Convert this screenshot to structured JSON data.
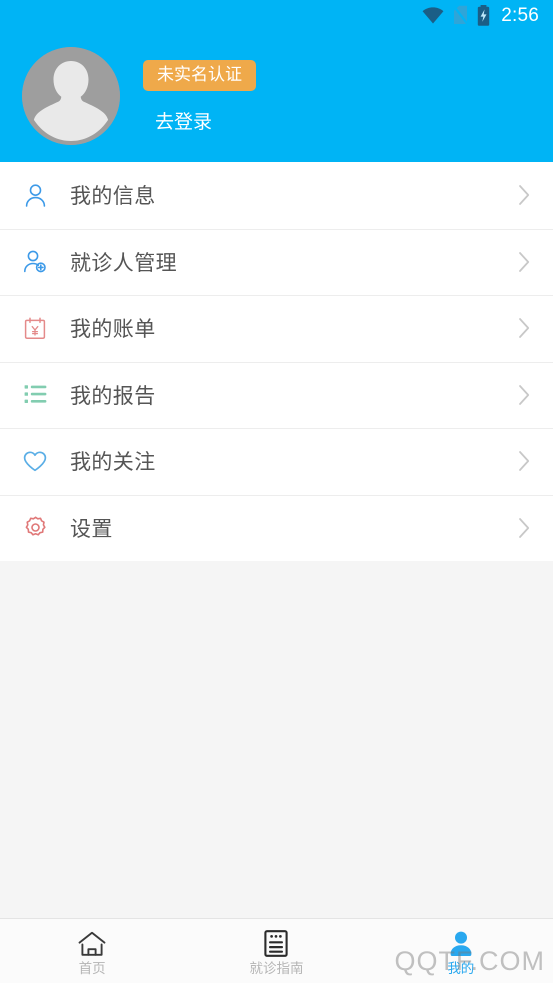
{
  "statusbar": {
    "time": "2:56",
    "icons": [
      "wifi-icon",
      "no-sim-icon",
      "battery-charging-icon"
    ]
  },
  "header": {
    "background_color": "#00b4f5",
    "avatar_icon": "default-user-avatar",
    "verify_badge": {
      "label": "未实名认证",
      "background_color": "#efa94a",
      "text_color": "#ffffff"
    },
    "login_link": "去登录"
  },
  "menu": {
    "items": [
      {
        "label": "我的信息",
        "icon": "user-icon",
        "icon_color": "#3d9ae8",
        "chevron": "chevron-right-icon"
      },
      {
        "label": "就诊人管理",
        "icon": "user-add-icon",
        "icon_color": "#3d9ae8",
        "chevron": "chevron-right-icon"
      },
      {
        "label": "我的账单",
        "icon": "bill-yuan-icon",
        "icon_color": "#e48a8a",
        "chevron": "chevron-right-icon"
      },
      {
        "label": "我的报告",
        "icon": "list-report-icon",
        "icon_color": "#82cdb0",
        "chevron": "chevron-right-icon"
      },
      {
        "label": "我的关注",
        "icon": "heart-icon",
        "icon_color": "#5aaee6",
        "chevron": "chevron-right-icon"
      },
      {
        "label": "设置",
        "icon": "gear-icon",
        "icon_color": "#e07878",
        "chevron": "chevron-right-icon"
      }
    ]
  },
  "bottomnav": {
    "active_color": "#29a8ef",
    "inactive_color": "#b5b5b5",
    "items": [
      {
        "label": "首页",
        "icon": "home-icon",
        "active": false
      },
      {
        "label": "就诊指南",
        "icon": "document-icon",
        "active": false
      },
      {
        "label": "我的",
        "icon": "person-icon",
        "active": true
      }
    ]
  },
  "watermark": {
    "text": "QQTF.COM"
  }
}
